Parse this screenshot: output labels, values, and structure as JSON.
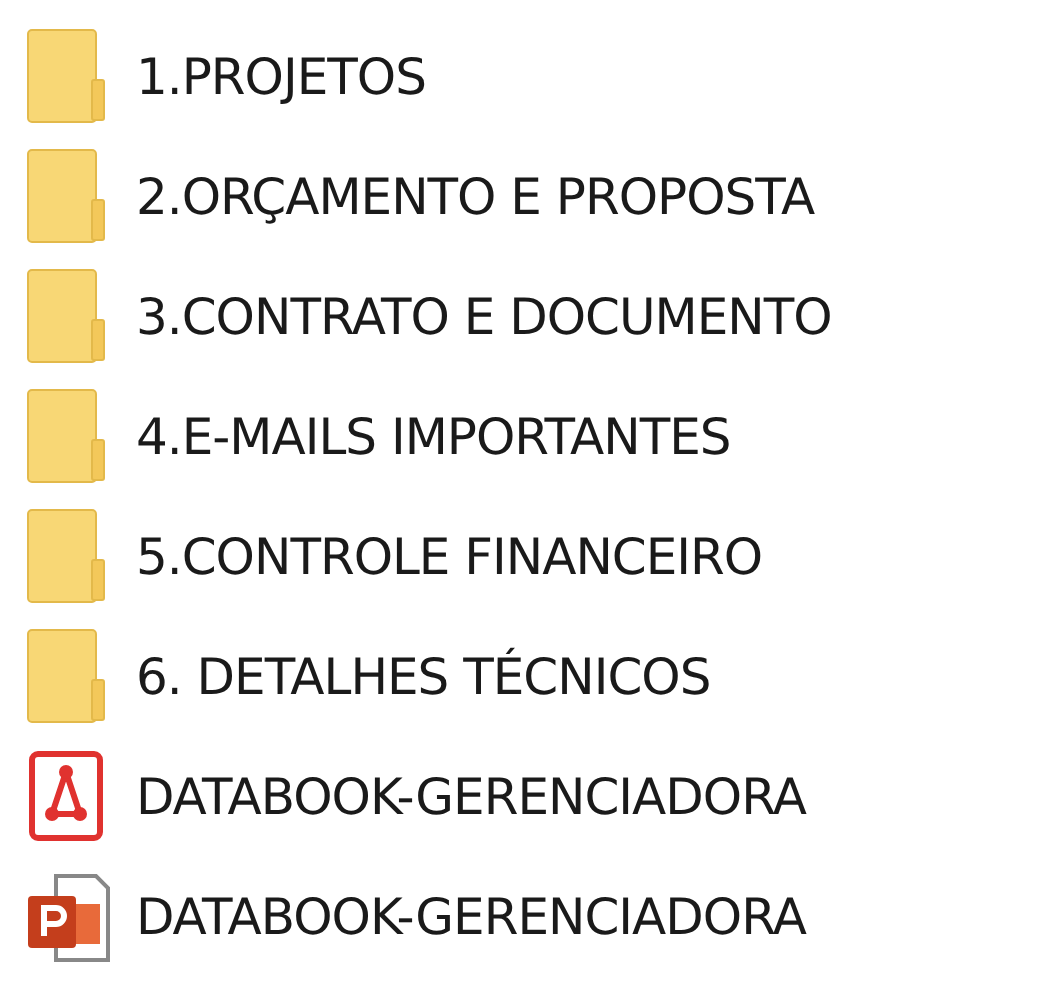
{
  "files": [
    {
      "kind": "folder",
      "name": "1.PROJETOS"
    },
    {
      "kind": "folder",
      "name": "2.ORÇAMENTO E PROPOSTA"
    },
    {
      "kind": "folder",
      "name": "3.CONTRATO E DOCUMENTO"
    },
    {
      "kind": "folder",
      "name": "4.E-MAILS IMPORTANTES"
    },
    {
      "kind": "folder",
      "name": "5.CONTROLE FINANCEIRO"
    },
    {
      "kind": "folder",
      "name": "6. DETALHES TÉCNICOS"
    },
    {
      "kind": "pdf",
      "name": "DATABOOK-GERENCIADORA"
    },
    {
      "kind": "pptx",
      "name": "DATABOOK-GERENCIADORA"
    }
  ]
}
